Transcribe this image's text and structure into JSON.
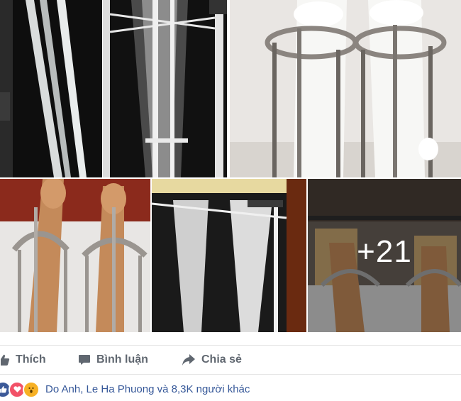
{
  "photos": {
    "more_count_label": "+21",
    "tiles": [
      {
        "name": "xray-pins-left"
      },
      {
        "name": "xray-fixator-center"
      },
      {
        "name": "bandaged-legs-fixator"
      },
      {
        "name": "legs-rings-feet"
      },
      {
        "name": "xray-tibia-pins"
      },
      {
        "name": "hospital-bed-legs"
      }
    ]
  },
  "actions": {
    "like_label": "Thích",
    "comment_label": "Bình luận",
    "share_label": "Chia sẻ"
  },
  "reactions": {
    "icons": [
      "like-icon",
      "love-icon",
      "wow-icon"
    ],
    "summary": "Do Anh, Le Ha Phuong và 8,3K người khác"
  },
  "colors": {
    "like_blue": "#3b5998",
    "love_red": "#f25268",
    "wow_yellow": "#f7b125",
    "action_gray": "#606770",
    "link_blue": "#365899"
  }
}
